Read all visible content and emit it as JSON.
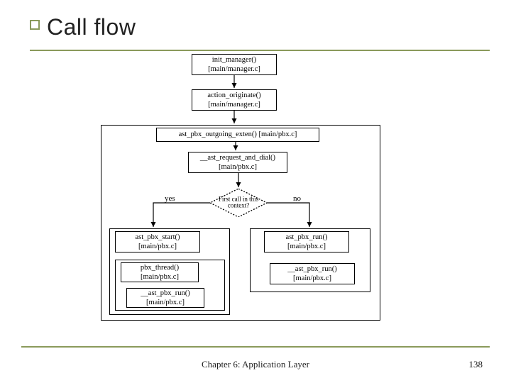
{
  "title": "Call flow",
  "footer": {
    "center": "Chapter 6: Application Layer",
    "page": "138"
  },
  "nodes": {
    "init_manager": {
      "fn": "init_manager()",
      "src": "[main/manager.c]"
    },
    "action_originate": {
      "fn": "action_originate()",
      "src": "[main/manager.c]"
    },
    "outgoing_exten": "ast_pbx_outgoing_exten() [main/pbx.c]",
    "request_dial": {
      "fn": "__ast_request_and_dial()",
      "src": "[main/pbx.c]"
    },
    "decision": "First call in this context?",
    "yes": "yes",
    "no": "no",
    "pbx_start": {
      "fn": "ast_pbx_start()",
      "src": "[main/pbx.c]"
    },
    "pbx_run_r": {
      "fn": "ast_pbx_run()",
      "src": "[main/pbx.c]"
    },
    "pbx_thread": {
      "fn": "pbx_thread()",
      "src": "[main/pbx.c]"
    },
    "ast_pbx_run2": {
      "fn": "__ast_pbx_run()",
      "src": "[main/pbx.c]"
    },
    "ast_pbx_run_inner": {
      "fn": "__ast_pbx_run()",
      "src": "[main/pbx.c]"
    }
  }
}
